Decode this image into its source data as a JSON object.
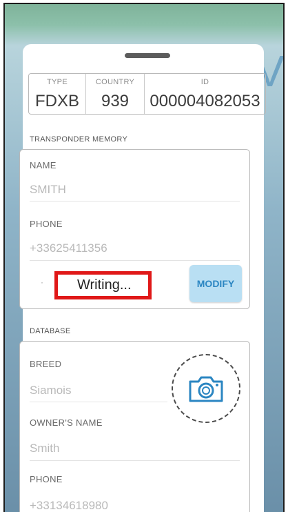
{
  "id_box": {
    "type_label": "TYPE",
    "type_value": "FDXB",
    "country_label": "COUNTRY",
    "country_value": "939",
    "id_label": "ID",
    "id_value": "000004082053"
  },
  "transponder": {
    "title": "TRANSPONDER MEMORY",
    "name_label": "NAME",
    "name_value": "SMITH",
    "phone_label": "PHONE",
    "phone_value": "+33625411356",
    "status_text": "Writing...",
    "modify_label": "MODIFY"
  },
  "database": {
    "title": "DATABASE",
    "breed_label": "BREED",
    "breed_value": "Siamois",
    "owner_label": "OWNER'S NAME",
    "owner_value": "Smith",
    "phone_label": "PHONE",
    "phone_value": "+33134618980"
  },
  "colors": {
    "accent": "#2b86c2",
    "button_bg": "#b9dff3",
    "highlight": "#e01818"
  },
  "icons": {
    "camera": "camera-icon"
  }
}
